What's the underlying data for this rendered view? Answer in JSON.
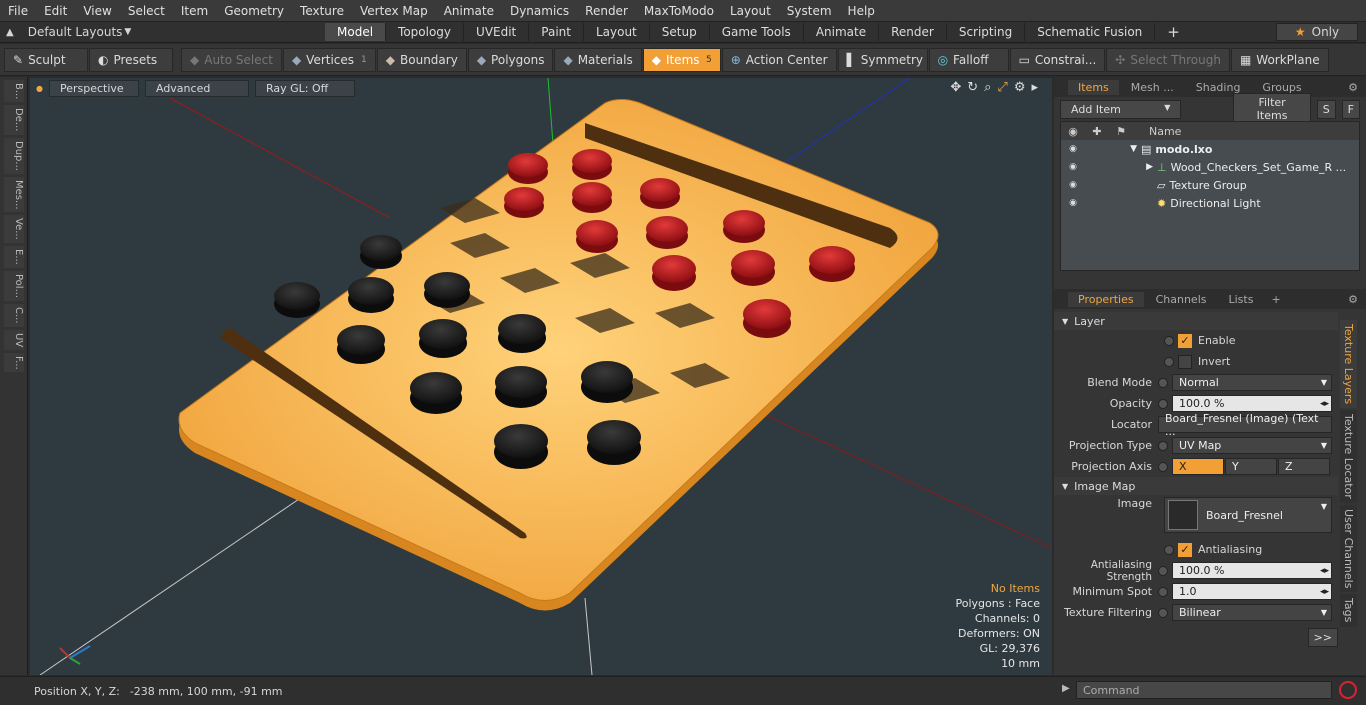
{
  "menu": [
    "File",
    "Edit",
    "View",
    "Select",
    "Item",
    "Geometry",
    "Texture",
    "Vertex Map",
    "Animate",
    "Dynamics",
    "Render",
    "MaxToModo",
    "Layout",
    "System",
    "Help"
  ],
  "layouts": {
    "label": "Default Layouts"
  },
  "tabs": [
    "Model",
    "Topology",
    "UVEdit",
    "Paint",
    "Layout",
    "Setup",
    "Game Tools",
    "Animate",
    "Render",
    "Scripting",
    "Schematic Fusion"
  ],
  "active_tab": "Model",
  "only_label": "Only",
  "toolbar": {
    "sculpt": "Sculpt",
    "presets": "Presets",
    "auto_select": "Auto Select",
    "vertices": "Vertices",
    "vertices_count": "1",
    "boundary": "Boundary",
    "polygons": "Polygons",
    "materials": "Materials",
    "items": "Items",
    "items_count": "5",
    "action_center": "Action Center",
    "symmetry": "Symmetry",
    "falloff": "Falloff",
    "constraints": "Constrai...",
    "select_through": "Select Through",
    "workplane": "WorkPlane"
  },
  "left_tabs": [
    "B...",
    "De...",
    "Dup...",
    "Mes...",
    "Ve...",
    "E...",
    "Pol...",
    "C...",
    "UV",
    "F..."
  ],
  "viewport": {
    "perspective": "Perspective",
    "advanced": "Advanced",
    "raygl": "Ray GL: Off",
    "info": {
      "no_items": "No Items",
      "polygons": "Polygons : Face",
      "channels": "Channels: 0",
      "deformers": "Deformers: ON",
      "gl": "GL: 29,376",
      "scale": "10 mm"
    }
  },
  "status": {
    "position": "Position X, Y, Z:",
    "coords": "-238 mm, 100 mm, -91 mm"
  },
  "items_panel": {
    "tabs": [
      "Items",
      "Mesh ...",
      "Shading",
      "Groups"
    ],
    "add_item": "Add Item",
    "filter_items": "Filter Items",
    "s": "S",
    "f": "F",
    "col_name": "Name",
    "rows": [
      "modo.lxo",
      "Wood_Checkers_Set_Game_R ...",
      "Texture Group",
      "Directional Light"
    ]
  },
  "props_panel": {
    "tabs": [
      "Properties",
      "Channels",
      "Lists"
    ],
    "layer": "Layer",
    "enable": "Enable",
    "invert": "Invert",
    "blend_mode_label": "Blend Mode",
    "blend_mode": "Normal",
    "opacity_label": "Opacity",
    "opacity": "100.0 %",
    "locator_label": "Locator",
    "locator": "Board_Fresnel (Image) (Text ...",
    "proj_type_label": "Projection Type",
    "proj_type": "UV Map",
    "proj_axis_label": "Projection Axis",
    "axis_x": "X",
    "axis_y": "Y",
    "axis_z": "Z",
    "image_map": "Image Map",
    "image_label": "Image",
    "image": "Board_Fresnel",
    "antialiasing": "Antialiasing",
    "aa_strength_label": "Antialiasing Strength",
    "aa_strength": "100.0 %",
    "min_spot_label": "Minimum Spot",
    "min_spot": "1.0",
    "tex_filter_label": "Texture Filtering",
    "tex_filter": "Bilinear",
    "more": ">>"
  },
  "right_vtabs": [
    "Texture Layers",
    "Texture Locator",
    "User Channels",
    "Tags"
  ],
  "command_placeholder": "Command",
  "colors": {
    "accent": "#f2a035",
    "board": "#f0a23a",
    "red_piece": "#b8141b",
    "black_piece": "#1e1e1e",
    "viewport_bg": "#2f3a40"
  }
}
